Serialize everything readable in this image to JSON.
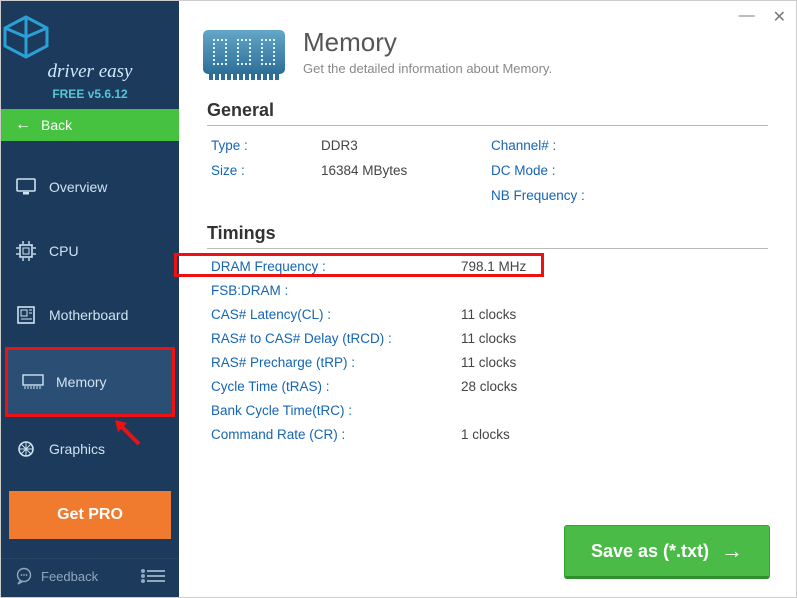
{
  "brand": {
    "name": "driver easy",
    "version": "FREE v5.6.12"
  },
  "backLabel": "Back",
  "nav": {
    "overview": "Overview",
    "cpu": "CPU",
    "motherboard": "Motherboard",
    "memory": "Memory",
    "graphics": "Graphics"
  },
  "getPro": "Get PRO",
  "feedback": "Feedback",
  "header": {
    "title": "Memory",
    "subtitle": "Get the detailed information about Memory."
  },
  "general": {
    "title": "General",
    "labels": {
      "type": "Type :",
      "size": "Size :",
      "channel": "Channel# :",
      "dcmode": "DC Mode :",
      "nbfreq": "NB Frequency :"
    },
    "values": {
      "type": "DDR3",
      "size": "16384 MBytes",
      "channel": "",
      "dcmode": "",
      "nbfreq": ""
    }
  },
  "timings": {
    "title": "Timings",
    "labels": {
      "dram": "DRAM Frequency :",
      "fsb": "FSB:DRAM :",
      "cas": "CAS# Latency(CL) :",
      "trcd": "RAS# to CAS# Delay (tRCD) :",
      "trp": "RAS# Precharge (tRP) :",
      "tras": "Cycle Time (tRAS) :",
      "trc": "Bank Cycle Time(tRC) :",
      "cr": "Command Rate (CR) :"
    },
    "values": {
      "dram": "798.1 MHz",
      "fsb": "",
      "cas": "11 clocks",
      "trcd": "11 clocks",
      "trp": "11 clocks",
      "tras": "28 clocks",
      "trc": "",
      "cr": "1 clocks"
    }
  },
  "save": "Save as (*.txt)"
}
